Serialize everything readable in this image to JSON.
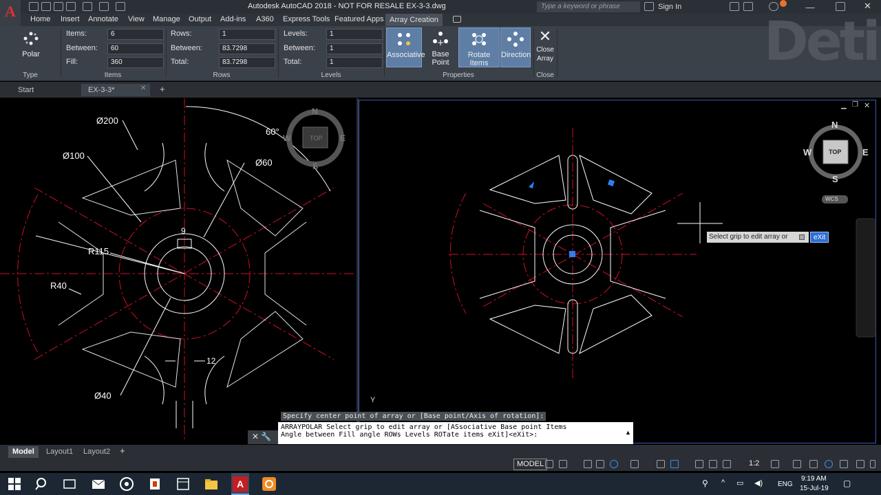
{
  "titlebar": {
    "app_logo": "A",
    "title": "Autodesk AutoCAD 2018 - NOT FOR RESALE    EX-3-3.dwg",
    "search_placeholder": "Type a keyword or phrase",
    "signin": "Sign In"
  },
  "ribbon_tabs": [
    "Home",
    "Insert",
    "Annotate",
    "View",
    "Manage",
    "Output",
    "Add-ins",
    "A360",
    "Express Tools",
    "Featured Apps",
    "Array Creation"
  ],
  "ribbon": {
    "type": {
      "button": "Polar",
      "label": "Type"
    },
    "items": {
      "items_label": "Items:",
      "items_value": "6",
      "between_label": "Between:",
      "between_value": "60",
      "fill_label": "Fill:",
      "fill_value": "360",
      "label": "Items"
    },
    "rows": {
      "rows_label": "Rows:",
      "rows_value": "1",
      "between_label": "Between:",
      "between_value": "83.7298",
      "total_label": "Total:",
      "total_value": "83.7298",
      "label": "Rows"
    },
    "levels": {
      "levels_label": "Levels:",
      "levels_value": "1",
      "between_label": "Between:",
      "between_value": "1",
      "total_label": "Total:",
      "total_value": "1",
      "label": "Levels"
    },
    "properties": {
      "associative": "Associative",
      "base_point": "Base Point",
      "rotate_items": "Rotate Items",
      "direction": "Direction",
      "label": "Properties"
    },
    "close": {
      "button": "Close Array",
      "label": "Close"
    }
  },
  "file_tabs": [
    "Start",
    "EX-3-3*"
  ],
  "left_drawing": {
    "dims": {
      "d200": "Ø200",
      "d100": "Ø100",
      "d60": "Ø60",
      "d40": "Ø40",
      "r115": "R115",
      "r40": "R40",
      "w9": "9",
      "w12": "12",
      "angle": "60°"
    },
    "viewcube": {
      "n": "N",
      "w": "W",
      "e": "E",
      "s": "S",
      "top": "TOP"
    }
  },
  "right_drawing": {
    "viewcube": {
      "n": "N",
      "w": "W",
      "e": "E",
      "s": "S",
      "top": "TOP",
      "wcs": "WCS"
    },
    "tooltip": "Select grip to edit array or",
    "tooltip_option": "eXit",
    "ucs_y": "Y"
  },
  "command": {
    "hint": "Specify center point of array or [Base point/Axis of rotation]:",
    "line1": "ARRAYPOLAR Select grip to edit array or [ASsociative Base point Items",
    "line2": "Angle between Fill angle ROWs Levels ROTate items eXit]<eXit>:"
  },
  "layout_tabs": [
    "Model",
    "Layout1",
    "Layout2"
  ],
  "status": {
    "model": "MODEL",
    "scale": "1:2"
  },
  "taskbar": {
    "lang": "ENG",
    "time": "9:19 AM",
    "date": "15-Jul-19"
  },
  "watermark": "Deti",
  "colors": {
    "accent": "#5f7ea6",
    "center_line": "#d0102a",
    "geometry": "#ffffff"
  }
}
